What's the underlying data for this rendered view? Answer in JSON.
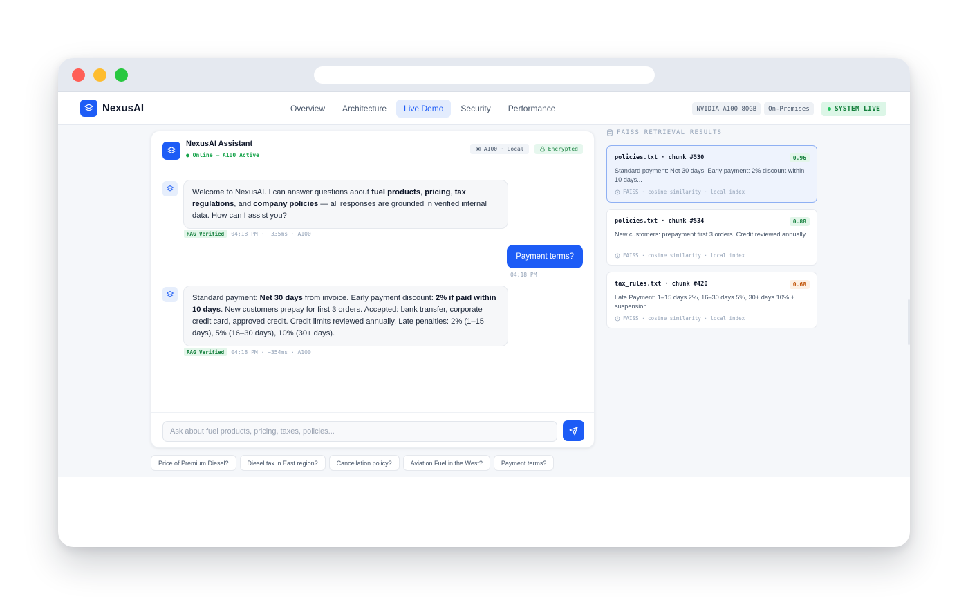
{
  "nav": {
    "brand": "NexusAI",
    "links": [
      "Overview",
      "Architecture",
      "Live Demo",
      "Security",
      "Performance"
    ],
    "active": "Live Demo",
    "tags": [
      "NVIDIA A100 80GB",
      "On-Premises"
    ],
    "live": "SYSTEM LIVE"
  },
  "chat": {
    "assistant_name": "NexusAI Assistant",
    "status": "● Online — A100 Active",
    "badge_gpu": "A100 · Local",
    "badge_enc": "Encrypted",
    "messages": [
      {
        "role": "assistant",
        "parts": [
          {
            "t": "Welcome to NexusAI. I can answer questions about "
          },
          {
            "t": "fuel products",
            "b": true
          },
          {
            "t": ", "
          },
          {
            "t": "pricing",
            "b": true
          },
          {
            "t": ", "
          },
          {
            "t": "tax regulations",
            "b": true
          },
          {
            "t": ", and "
          },
          {
            "t": "company policies",
            "b": true
          },
          {
            "t": " — all responses are grounded in verified internal data. How can I assist you?"
          }
        ],
        "badge": "RAG Verified",
        "meta": "04:18 PM · ~335ms · A100"
      },
      {
        "role": "user",
        "text": "Payment terms?",
        "time": "04:18 PM"
      },
      {
        "role": "assistant",
        "parts": [
          {
            "t": "Standard payment: "
          },
          {
            "t": "Net 30 days",
            "b": true
          },
          {
            "t": " from invoice. Early payment discount: "
          },
          {
            "t": "2% if paid within 10 days",
            "b": true
          },
          {
            "t": ". New customers prepay for first 3 orders. Accepted: bank transfer, corporate credit card, approved credit. Credit limits reviewed annually. Late penalties: 2% (1–15 days), 5% (16–30 days), 10% (30+ days)."
          }
        ],
        "badge": "RAG Verified",
        "meta": "04:18 PM · ~354ms · A100"
      }
    ],
    "input_placeholder": "Ask about fuel products, pricing, taxes, policies...",
    "input_value": ""
  },
  "suggestions": [
    "Price of Premium Diesel?",
    "Diesel tax in East region?",
    "Cancellation policy?",
    "Aviation Fuel in the West?",
    "Payment terms?"
  ],
  "faiss": {
    "title": "FAISS RETRIEVAL RESULTS",
    "results": [
      {
        "file": "policies.txt · chunk #530",
        "score": "0.96",
        "text": "Standard payment: Net 30 days. Early payment: 2% discount within 10 days...",
        "meta": "FAISS · cosine similarity · local index"
      },
      {
        "file": "policies.txt · chunk #534",
        "score": "0.88",
        "text": "New customers: prepayment first 3 orders. Credit reviewed annually...",
        "meta": "FAISS · cosine similarity · local index"
      },
      {
        "file": "tax_rules.txt · chunk #420",
        "score": "0.68",
        "text": "Late Payment: 1–15 days 2%, 16–30 days 5%, 30+ days 10% + suspension...",
        "meta": "FAISS · cosine similarity · local index"
      }
    ]
  },
  "colors": {
    "accent": "#1d5cf6",
    "live_green": "#15803d",
    "score_mid": "#c2570c"
  }
}
